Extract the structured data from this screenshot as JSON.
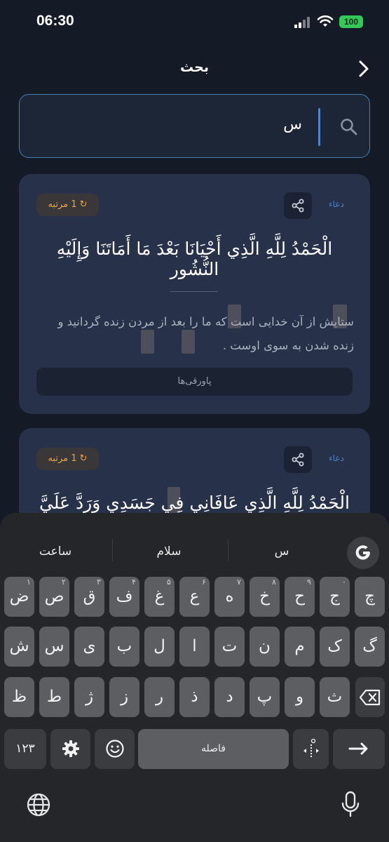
{
  "status": {
    "time": "06:30",
    "battery": "100"
  },
  "header": {
    "title": "بحث"
  },
  "search": {
    "value": "س"
  },
  "cards": [
    {
      "tag": "دعاء",
      "count": "1 مرتبه",
      "arabic": "الْحَمْدُ لِلَّهِ الَّذِي أَحْيَانَا بَعْدَ مَا أَمَاتَنَا وَإِلَيْهِ النُّشُور",
      "translation": "ستایش از آن خدایی است که ما را بعد از مردن زنده گردانید و زنده شدن به سوی اوست .",
      "footnotes": "پاورقی‌ها"
    },
    {
      "tag": "دعاء",
      "count": "1 مرتبه",
      "arabic": "الْحَمْدُ لِلَّهِ الَّذِي عَافَانِي فِي جَسَدِي وَرَدَّ عَلَيَّ رُوحِي"
    }
  ],
  "keyboard": {
    "suggestions": [
      "س",
      "سلام",
      "ساعت"
    ],
    "row1": [
      {
        "ch": "ض",
        "n": "۱"
      },
      {
        "ch": "ص",
        "n": "۲"
      },
      {
        "ch": "ق",
        "n": "۳"
      },
      {
        "ch": "ف",
        "n": "۴"
      },
      {
        "ch": "غ",
        "n": "۵"
      },
      {
        "ch": "ع",
        "n": "۶"
      },
      {
        "ch": "ه",
        "n": "۷"
      },
      {
        "ch": "خ",
        "n": "۸"
      },
      {
        "ch": "ح",
        "n": "۹"
      },
      {
        "ch": "ج",
        "n": "۰"
      },
      {
        "ch": "چ",
        "n": ""
      }
    ],
    "row2": [
      "ش",
      "س",
      "ی",
      "ب",
      "ل",
      "ا",
      "ت",
      "ن",
      "م",
      "ک",
      "گ"
    ],
    "row3": [
      "ظ",
      "ط",
      "ژ",
      "ز",
      "ر",
      "ذ",
      "د",
      "پ",
      "و",
      "ث"
    ],
    "numbers_key": "۱۲۳",
    "space": "فاصله"
  },
  "icons": {
    "back": "chevron-right-icon",
    "search": "search-icon",
    "share": "share-icon",
    "repeat": "repeat-icon",
    "google": "google-g-icon",
    "backspace": "backspace-icon",
    "settings": "gear-icon",
    "emoji": "smiley-icon",
    "enter": "return-arrow-icon",
    "globe": "globe-icon",
    "mic": "microphone-icon",
    "cursor": "cursor-move-icon"
  },
  "colors": {
    "background": "#141a26",
    "card": "#27324a",
    "accent": "#4f86c9",
    "badge_text": "#e6a44b",
    "battery": "#34c759"
  }
}
